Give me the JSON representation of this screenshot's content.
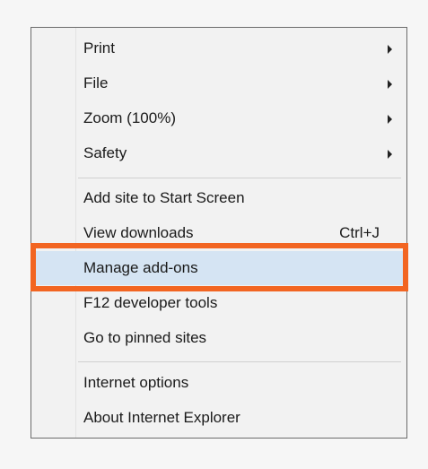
{
  "menu": {
    "items": [
      {
        "label": "Print",
        "submenu": true
      },
      {
        "label": "File",
        "submenu": true
      },
      {
        "label": "Zoom (100%)",
        "submenu": true
      },
      {
        "label": "Safety",
        "submenu": true
      },
      {
        "label": "Add site to Start Screen"
      },
      {
        "label": "View downloads",
        "shortcut": "Ctrl+J"
      },
      {
        "label": "Manage add-ons",
        "selected": true
      },
      {
        "label": "F12 developer tools"
      },
      {
        "label": "Go to pinned sites"
      },
      {
        "label": "Internet options"
      },
      {
        "label": "About Internet Explorer"
      }
    ]
  },
  "colors": {
    "highlight_border": "#f26522",
    "selected_background": "#d5e4f3",
    "menu_background": "#f2f2f2"
  },
  "icons": {
    "submenu": "chevron-right-icon"
  }
}
